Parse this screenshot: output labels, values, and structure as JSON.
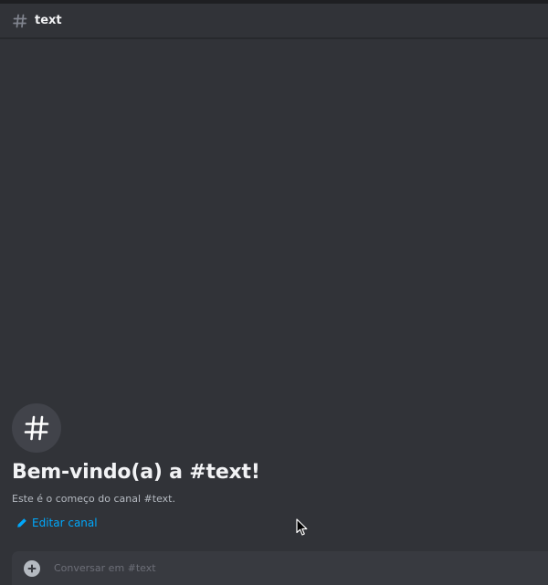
{
  "header": {
    "icon": "hashtag-icon",
    "channel_name": "text"
  },
  "welcome": {
    "icon": "hashtag-icon",
    "title": "Bem-vindo(a) a #text!",
    "subtitle": "Este é o começo do canal #text.",
    "edit_label": "Editar canal",
    "edit_icon": "pencil-icon"
  },
  "composer": {
    "add_icon": "plus-circle-icon",
    "placeholder": "Conversar em #text"
  },
  "colors": {
    "background": "#313338",
    "link": "#00a8fc",
    "composer_bg": "#383a40",
    "title_text": "#f2f3f5",
    "muted_text": "#b5bac1"
  }
}
